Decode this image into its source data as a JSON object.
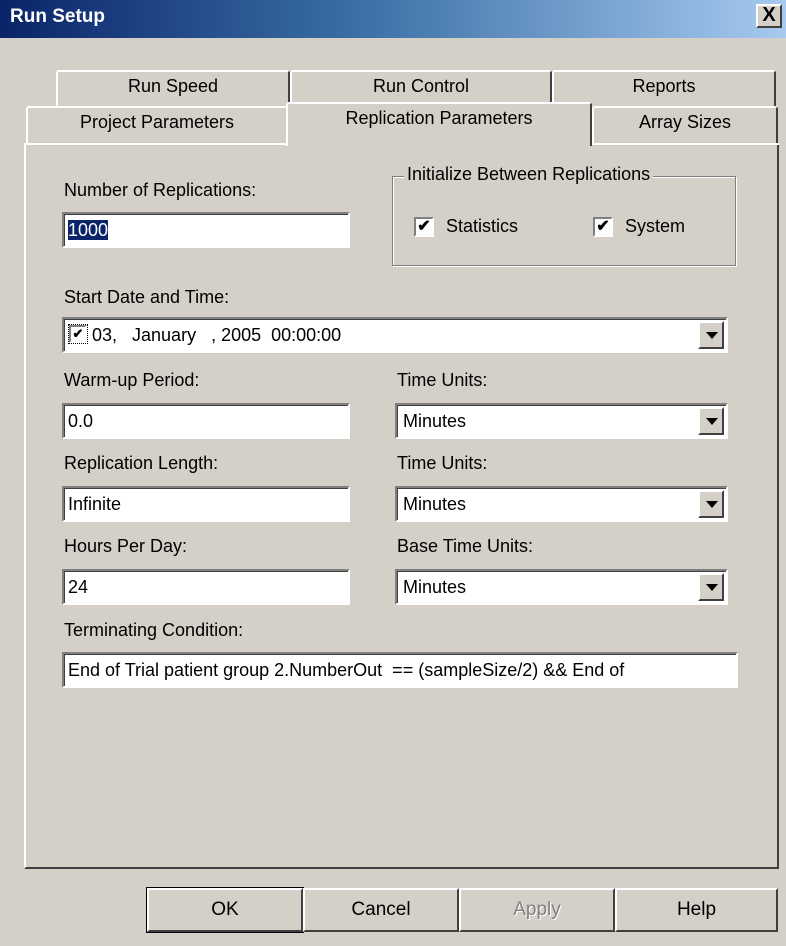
{
  "window": {
    "title": "Run Setup",
    "close_label": "X"
  },
  "tabs": {
    "row1": [
      {
        "label": "Run Speed"
      },
      {
        "label": "Run Control"
      },
      {
        "label": "Reports"
      }
    ],
    "row2": [
      {
        "label": "Project Parameters"
      },
      {
        "label": "Replication Parameters",
        "selected": true
      },
      {
        "label": "Array Sizes"
      }
    ]
  },
  "form": {
    "num_replications_label": "Number of Replications:",
    "num_replications_value": "1000",
    "init_group_title": "Initialize Between Replications",
    "statistics_label": "Statistics",
    "statistics_checked": true,
    "system_label": "System",
    "system_checked": true,
    "check_mark": "✔",
    "start_date_label": "Start Date and Time:",
    "start_date_value": "03,   January   , 2005  00:00:00",
    "warmup_label": "Warm-up Period:",
    "warmup_value": "0.0",
    "warmup_units_label": "Time Units:",
    "warmup_units_value": "Minutes",
    "rep_length_label": "Replication Length:",
    "rep_length_value": "Infinite",
    "rep_length_units_label": "Time Units:",
    "rep_length_units_value": "Minutes",
    "hours_per_day_label": "Hours Per Day:",
    "hours_per_day_value": "24",
    "base_units_label": "Base Time Units:",
    "base_units_value": "Minutes",
    "terminating_label": "Terminating Condition:",
    "terminating_value": "End of Trial patient group 2.NumberOut  == (sampleSize/2) && End of"
  },
  "buttons": {
    "ok": "OK",
    "cancel": "Cancel",
    "apply": "Apply",
    "apply_enabled": false,
    "help": "Help"
  }
}
